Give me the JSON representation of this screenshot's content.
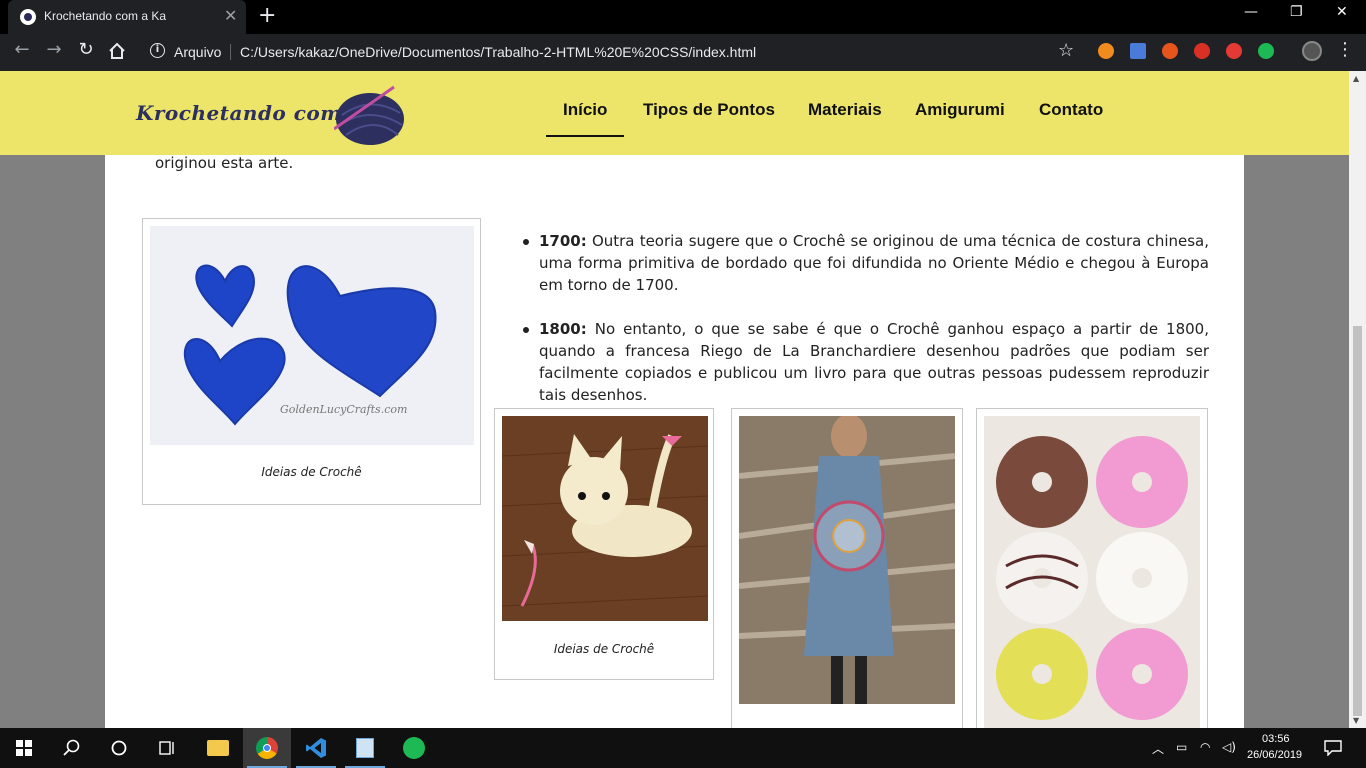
{
  "browser": {
    "tab_title": "Krochetando com a Ka",
    "tab_close": "✕",
    "new_tab": "+",
    "omnibox_label": "Arquivo",
    "url": "C:/Users/kakaz/OneDrive/Documentos/Trabalho-2-HTML%20E%20CSS/index.html",
    "window_controls": [
      "—",
      "❐",
      "✕"
    ],
    "extension_colors": [
      "#f28b1e",
      "#4a7bd8",
      "#e8551c",
      "#d93025",
      "#e53935",
      "#1db954"
    ]
  },
  "site": {
    "logo_text": "Krochetando com a Ka",
    "nav": [
      "Início",
      "Tipos de Pontos",
      "Materiais",
      "Amigurumi",
      "Contato"
    ],
    "active_nav": "Início",
    "accent_color": "#ece56a"
  },
  "content": {
    "lead_text": "originou esta arte.",
    "hearts_caption": "Ideias de Crochê",
    "hearts_watermark": "GoldenLucyCrafts.com",
    "bullets": [
      {
        "year": "1700:",
        "text": " Outra teoria sugere que o Crochê se originou de uma técnica de costura chinesa, uma forma primitiva de bordado que foi difundida no Oriente Médio e chegou à Europa em torno de 1700."
      },
      {
        "year": "1800:",
        "text": " No entanto, o que se sabe é que o Crochê ganhou espaço a partir de 1800, quando a francesa Riego de La Branchardiere desenhou padrões que podiam ser facilmente copiados e publicou um livro para que outras pessoas pudessem reproduzir tais desenhos."
      }
    ],
    "cat_caption": "Ideias de Crochê"
  },
  "taskbar": {
    "time": "03:56",
    "date": "26/06/2019"
  }
}
